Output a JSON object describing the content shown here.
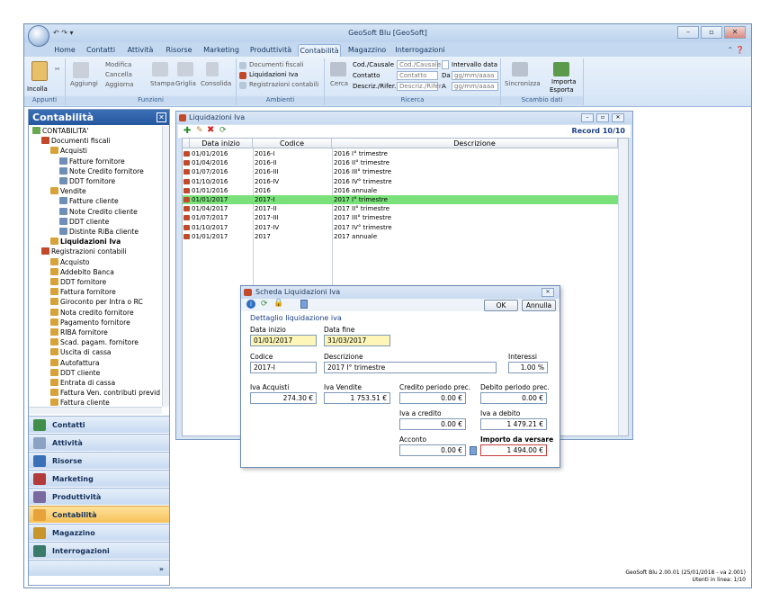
{
  "window": {
    "title": "GeoSoft Blu [GeoSoft]"
  },
  "ribbon_tabs": [
    "Home",
    "Contatti",
    "Attività",
    "Risorse",
    "Marketing",
    "Produttività",
    "Contabilità",
    "Magazzino",
    "Interrogazioni"
  ],
  "ribbon": {
    "appunti": {
      "incolla": "Incolla",
      "label": "Appunti"
    },
    "funzioni": {
      "aggiungi": "Aggiungi",
      "modifica": "Modifica",
      "cancella": "Cancella",
      "aggiorna": "Aggiorna",
      "stampa": "Stampa",
      "griglia": "Griglia",
      "consolida": "Consolida",
      "label": "Funzioni"
    },
    "ambienti": {
      "item1": "Documenti fiscali",
      "item2": "Liquidazioni Iva",
      "item3": "Registrazioni contabili",
      "label": "Ambienti"
    },
    "ricerca": {
      "cerca": "Cerca",
      "cod_causale": "Cod./Causale",
      "contatto": "Contatto",
      "descriz": "Descriz./Rifer.",
      "ph_cod": "Cod./Causale",
      "ph_contatto": "Contatto",
      "ph_descriz": "Descriz./Rifer",
      "intervallo": "Intervallo data",
      "da": "Da",
      "a": "A",
      "ph_date1": "gg/mm/aaaa",
      "ph_date2": "gg/mm/aaaa",
      "label": "Ricerca"
    },
    "scambio": {
      "sincronizza": "Sincronizza",
      "importa": "Importa",
      "esporta": "Esporta",
      "label": "Scambio dati"
    }
  },
  "left_panel": {
    "title": "Contabilità",
    "tree": [
      {
        "label": "CONTABILITA'",
        "level": 0
      },
      {
        "label": "Documenti fiscali",
        "level": 1
      },
      {
        "label": "Acquisti",
        "level": 2
      },
      {
        "label": "Fatture fornitore",
        "level": 3
      },
      {
        "label": "Note Credito fornitore",
        "level": 3
      },
      {
        "label": "DDT fornitore",
        "level": 3
      },
      {
        "label": "Vendite",
        "level": 2
      },
      {
        "label": "Fatture cliente",
        "level": 3
      },
      {
        "label": "Note Credito cliente",
        "level": 3
      },
      {
        "label": "DDT cliente",
        "level": 3
      },
      {
        "label": "Distinte RiBa cliente",
        "level": 3
      },
      {
        "label": "Liquidazioni Iva",
        "level": 2,
        "bold": true
      },
      {
        "label": "Registrazioni contabili",
        "level": 1
      },
      {
        "label": "Acquisto",
        "level": 2
      },
      {
        "label": "Addebito Banca",
        "level": 2
      },
      {
        "label": "DDT fornitore",
        "level": 2
      },
      {
        "label": "Fattura fornitore",
        "level": 2
      },
      {
        "label": "Giroconto per Intra o RC",
        "level": 2
      },
      {
        "label": "Nota credito fornitore",
        "level": 2
      },
      {
        "label": "Pagamento fornitore",
        "level": 2
      },
      {
        "label": "RIBA fornitore",
        "level": 2
      },
      {
        "label": "Scad. pagam. fornitore",
        "level": 2
      },
      {
        "label": "Uscita di cassa",
        "level": 2
      },
      {
        "label": "Autofattura",
        "level": 2
      },
      {
        "label": "DDT cliente",
        "level": 2
      },
      {
        "label": "Entrata di cassa",
        "level": 2
      },
      {
        "label": "Fattura Ven. contributi previd",
        "level": 2
      },
      {
        "label": "Fattura cliente",
        "level": 2
      }
    ],
    "nav": [
      "Contatti",
      "Attività",
      "Risorse",
      "Marketing",
      "Produttività",
      "Contabilità",
      "Magazzino",
      "Interrogazioni"
    ],
    "nav_selected": "Contabilità"
  },
  "list_window": {
    "title": "Liquidazioni Iva",
    "record": "Record 10/10",
    "columns": [
      "Data inizio",
      "Codice",
      "Descrizione"
    ],
    "rows": [
      [
        "01/01/2016",
        "2016-I",
        "2016 I° trimestre"
      ],
      [
        "01/04/2016",
        "2016-II",
        "2016 II° trimestre"
      ],
      [
        "01/07/2016",
        "2016-III",
        "2016 III° trimestre"
      ],
      [
        "01/10/2016",
        "2016-IV",
        "2016 IV° trimestre"
      ],
      [
        "01/01/2016",
        "2016",
        "2016 annuale"
      ],
      [
        "01/01/2017",
        "2017-I",
        "2017 I° trimestre"
      ],
      [
        "01/04/2017",
        "2017-II",
        "2017 II° trimestre"
      ],
      [
        "01/07/2017",
        "2017-III",
        "2017 III° trimestre"
      ],
      [
        "01/10/2017",
        "2017-IV",
        "2017 IV° trimestre"
      ],
      [
        "01/01/2017",
        "2017",
        "2017 annuale"
      ]
    ],
    "selected_row": 5
  },
  "dialog": {
    "title": "Scheda Liquidazioni Iva",
    "ok": "OK",
    "annulla": "Annulla",
    "section": "Dettaglio liquidazione iva",
    "data_inizio_label": "Data inizio",
    "data_inizio": "01/01/2017",
    "data_fine_label": "Data fine",
    "data_fine": "31/03/2017",
    "codice_label": "Codice",
    "codice": "2017-I",
    "descrizione_label": "Descrizione",
    "descrizione": "2017 I° trimestre",
    "interessi_label": "Interessi",
    "interessi": "1.00 %",
    "iva_acquisti_label": "Iva Acquisti",
    "iva_acquisti": "274.30 €",
    "iva_vendite_label": "Iva Vendite",
    "iva_vendite": "1 753.51 €",
    "credito_prec_label": "Credito periodo prec.",
    "credito_prec": "0.00 €",
    "debito_prec_label": "Debito periodo prec.",
    "debito_prec": "0.00 €",
    "iva_credito_label": "Iva a credito",
    "iva_credito": "0.00 €",
    "iva_debito_label": "Iva a debito",
    "iva_debito": "1 479.21 €",
    "acconto_label": "Acconto",
    "acconto": "0.00 €",
    "importo_label": "Importo da versare",
    "importo": "1 494.00 €"
  },
  "status": {
    "line1": "GeoSoft Blu 2.00.01 (25/01/2018 - va 2.001)",
    "line2": "Utenti in linea: 1/10"
  },
  "colors": {
    "selected_row": "#79e07a",
    "nav_selected": "#f6c25a",
    "header_blue": "#25579f",
    "yellow_field": "#fdf6b8",
    "red_border": "#c83c3c"
  }
}
